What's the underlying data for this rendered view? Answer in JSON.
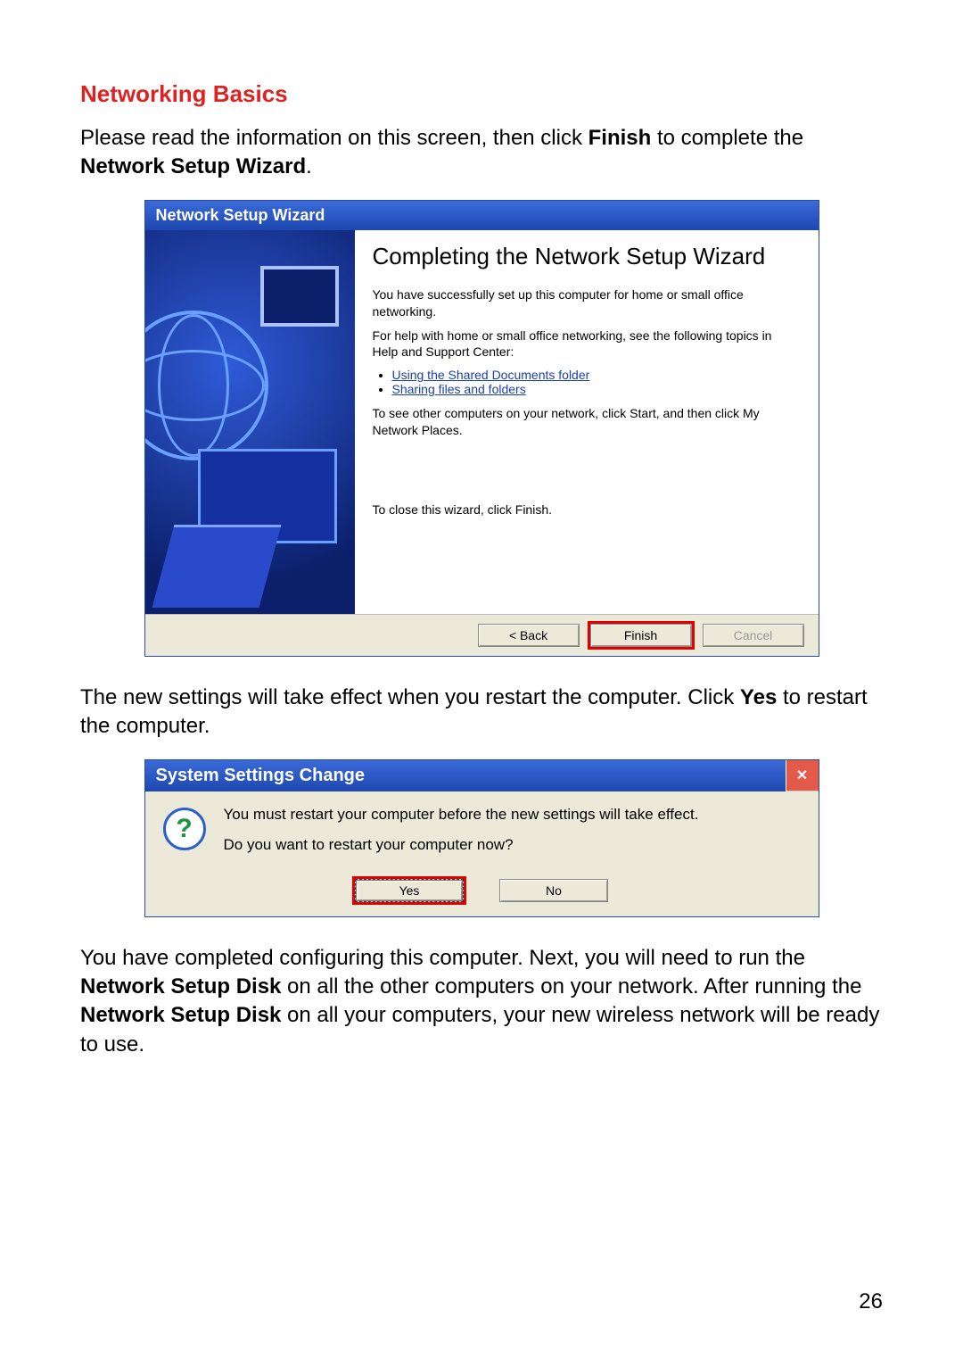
{
  "heading": "Networking Basics",
  "intro": {
    "before_finish": "Please read the information on this screen, then click ",
    "finish_word": "Finish",
    "after_finish": " to complete the ",
    "wizard_bold": "Network Setup Wizard",
    "period": "."
  },
  "wizard": {
    "title": "Network Setup Wizard",
    "heading": "Completing the Network Setup Wizard",
    "success": "You have successfully set up this computer for home or small office networking.",
    "help_intro": "For help with home or small office networking, see the following topics in Help and Support Center:",
    "links": [
      "Using the Shared Documents folder",
      "Sharing files and folders"
    ],
    "see_other": "To see other computers on your network, click Start, and then click My Network Places.",
    "close_hint": "To close this wizard, click Finish.",
    "buttons": {
      "back": "< Back",
      "finish": "Finish",
      "cancel": "Cancel"
    }
  },
  "mid_text": {
    "before_yes": "The new settings will take effect when you restart the computer.  Click ",
    "yes_word": "Yes",
    "after_yes": " to restart the computer."
  },
  "dialog": {
    "title": "System Settings Change",
    "close_glyph": "✕",
    "line1": "You must restart your computer before the new settings will take effect.",
    "line2": "Do you want to restart your computer now?",
    "buttons": {
      "yes": "Yes",
      "no": "No"
    }
  },
  "closing": {
    "t1": "You have completed configuring this computer.  Next, you will need to run the ",
    "b1": "Network Setup Disk",
    "t2": " on all the other computers on your network.  After running the ",
    "b2": "Network Setup Disk",
    "t3": " on all your computers, your new wireless network will be ready to use."
  },
  "page_number": "26"
}
